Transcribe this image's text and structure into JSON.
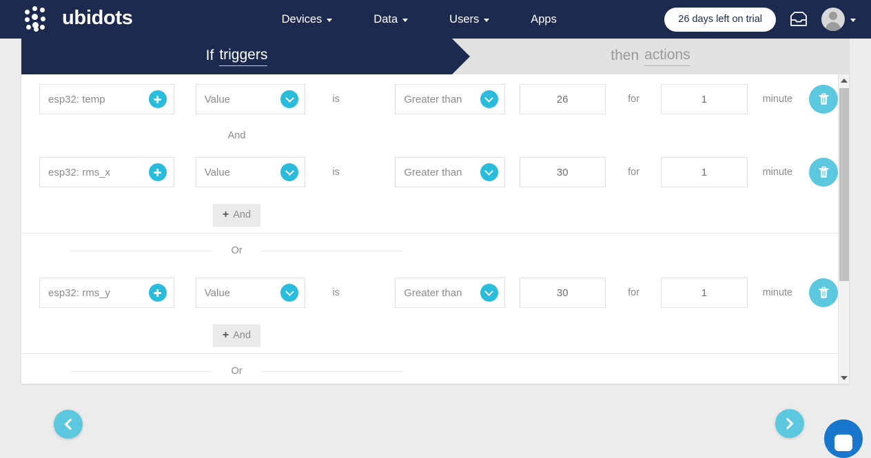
{
  "navbar": {
    "brand": "ubidots",
    "logo_icon": "ubidots-dot-matrix-logo",
    "links": [
      {
        "label": "Devices",
        "has_caret": true
      },
      {
        "label": "Data",
        "has_caret": true
      },
      {
        "label": "Users",
        "has_caret": true
      },
      {
        "label": "Apps",
        "has_caret": false
      }
    ],
    "trial_badge": "26 days left on trial",
    "inbox_icon": "inbox-icon",
    "avatar_icon": "user-avatar-icon",
    "avatar_caret_icon": "chevron-down-icon",
    "bg_color": "#1c2a4f"
  },
  "steps": {
    "if": {
      "prefix": "If",
      "emphasis": "triggers"
    },
    "then": {
      "prefix": "then",
      "emphasis": "actions"
    },
    "active_color": "#1c2a4f",
    "inactive_color": "#e2e2e2"
  },
  "labels": {
    "is": "is",
    "for": "for",
    "minute": "minute",
    "and": "And",
    "or": "Or",
    "add_and": "And",
    "add_and_plus": "+"
  },
  "groups": [
    {
      "rules": [
        {
          "variable": "esp32: temp",
          "add_icon": "plus-circle-icon",
          "kind": "Value",
          "kind_icon": "chevron-down-circle-icon",
          "condition": "Greater than",
          "condition_icon": "chevron-down-circle-icon",
          "threshold": "26",
          "duration": "1",
          "unit": "minute",
          "delete_icon": "trash-icon"
        },
        {
          "variable": "esp32: rms_x",
          "add_icon": "plus-circle-icon",
          "kind": "Value",
          "kind_icon": "chevron-down-circle-icon",
          "condition": "Greater than",
          "condition_icon": "chevron-down-circle-icon",
          "threshold": "30",
          "duration": "1",
          "unit": "minute",
          "delete_icon": "trash-icon"
        }
      ]
    },
    {
      "rules": [
        {
          "variable": "esp32: rms_y",
          "add_icon": "plus-circle-icon",
          "kind": "Value",
          "kind_icon": "chevron-down-circle-icon",
          "condition": "Greater than",
          "condition_icon": "chevron-down-circle-icon",
          "threshold": "30",
          "duration": "1",
          "unit": "minute",
          "delete_icon": "trash-icon"
        }
      ]
    }
  ],
  "footer": {
    "prev_icon": "chevron-left-icon",
    "next_icon": "chevron-right-icon",
    "chat_icon": "chat-bubble-icon",
    "accent_color": "#5cc8e0",
    "chat_color": "#1877cc"
  },
  "scrollbar": {
    "up_icon": "scroll-up-arrow-icon",
    "down_icon": "scroll-down-arrow-icon",
    "thumb": "scrollbar-thumb"
  }
}
